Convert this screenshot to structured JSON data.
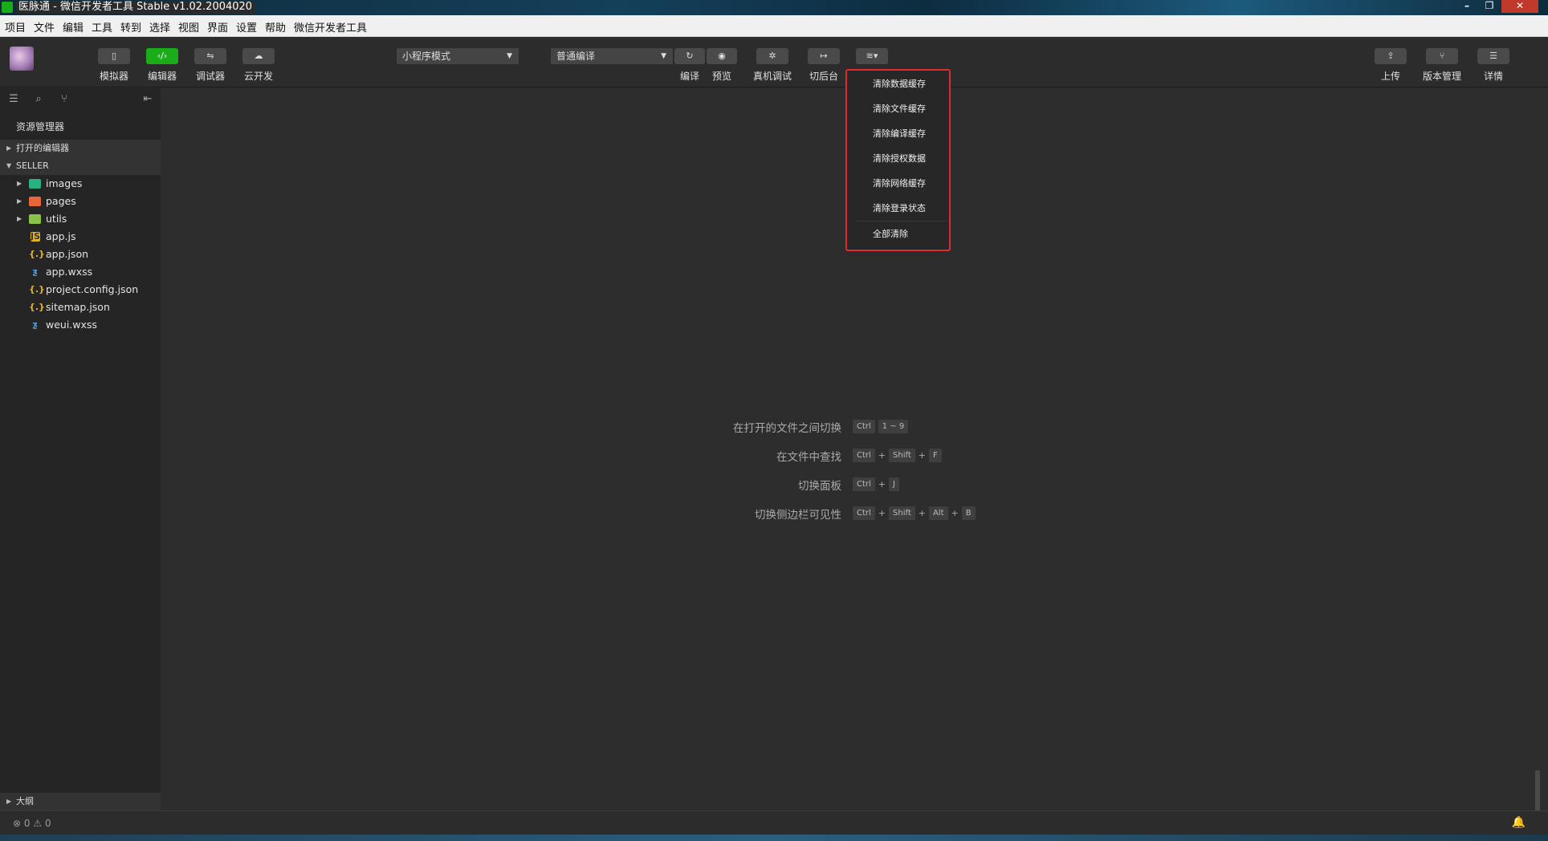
{
  "window": {
    "title": "医脉通 - 微信开发者工具 Stable v1.02.2004020"
  },
  "menu": [
    "项目",
    "文件",
    "编辑",
    "工具",
    "转到",
    "选择",
    "视图",
    "界面",
    "设置",
    "帮助",
    "微信开发者工具"
  ],
  "toolbar": {
    "simulator": "模拟器",
    "editor": "编辑器",
    "debugger": "调试器",
    "cloud": "云开发",
    "mode_select": "小程序模式",
    "compile_select": "普通编译",
    "compile": "编译",
    "preview": "预览",
    "real_debug": "真机调试",
    "background": "切后台",
    "upload": "上传",
    "version": "版本管理",
    "details": "详情"
  },
  "dropdown": {
    "items": [
      "清除数据缓存",
      "清除文件缓存",
      "清除编译缓存",
      "清除授权数据",
      "清除网络缓存",
      "清除登录状态"
    ],
    "clear_all": "全部清除",
    "highlight_color": "#e02b2b"
  },
  "sidebar": {
    "title": "资源管理器",
    "open_editors": "打开的编辑器",
    "project": "SELLER",
    "files": [
      {
        "name": "images",
        "type": "folder",
        "icon": "folder-icon",
        "color": "#2bb07f"
      },
      {
        "name": "pages",
        "type": "folder",
        "icon": "folder-icon",
        "color": "#e8663b"
      },
      {
        "name": "utils",
        "type": "folder",
        "icon": "folder-icon",
        "color": "#8bc34a"
      },
      {
        "name": "app.js",
        "type": "file",
        "icon": "js-icon",
        "color": "#e6b422"
      },
      {
        "name": "app.json",
        "type": "file",
        "icon": "json-icon",
        "color": "#e6b422"
      },
      {
        "name": "app.wxss",
        "type": "file",
        "icon": "css-icon",
        "color": "#42a5f5"
      },
      {
        "name": "project.config.json",
        "type": "file",
        "icon": "json-icon",
        "color": "#e6b422"
      },
      {
        "name": "sitemap.json",
        "type": "file",
        "icon": "json-icon",
        "color": "#e6b422"
      },
      {
        "name": "weui.wxss",
        "type": "file",
        "icon": "css-icon",
        "color": "#42a5f5"
      }
    ],
    "outline": "大纲"
  },
  "hints": [
    {
      "label": "在打开的文件之间切换",
      "keys": [
        "Ctrl",
        "1 ~ 9"
      ],
      "joined": false
    },
    {
      "label": "在文件中查找",
      "keys": [
        "Ctrl",
        "Shift",
        "F"
      ],
      "joined": true
    },
    {
      "label": "切换面板",
      "keys": [
        "Ctrl",
        "J"
      ],
      "joined": true
    },
    {
      "label": "切换侧边栏可见性",
      "keys": [
        "Ctrl",
        "Shift",
        "Alt",
        "B"
      ],
      "joined": true
    }
  ],
  "status": {
    "errors": "0",
    "warnings": "0"
  }
}
